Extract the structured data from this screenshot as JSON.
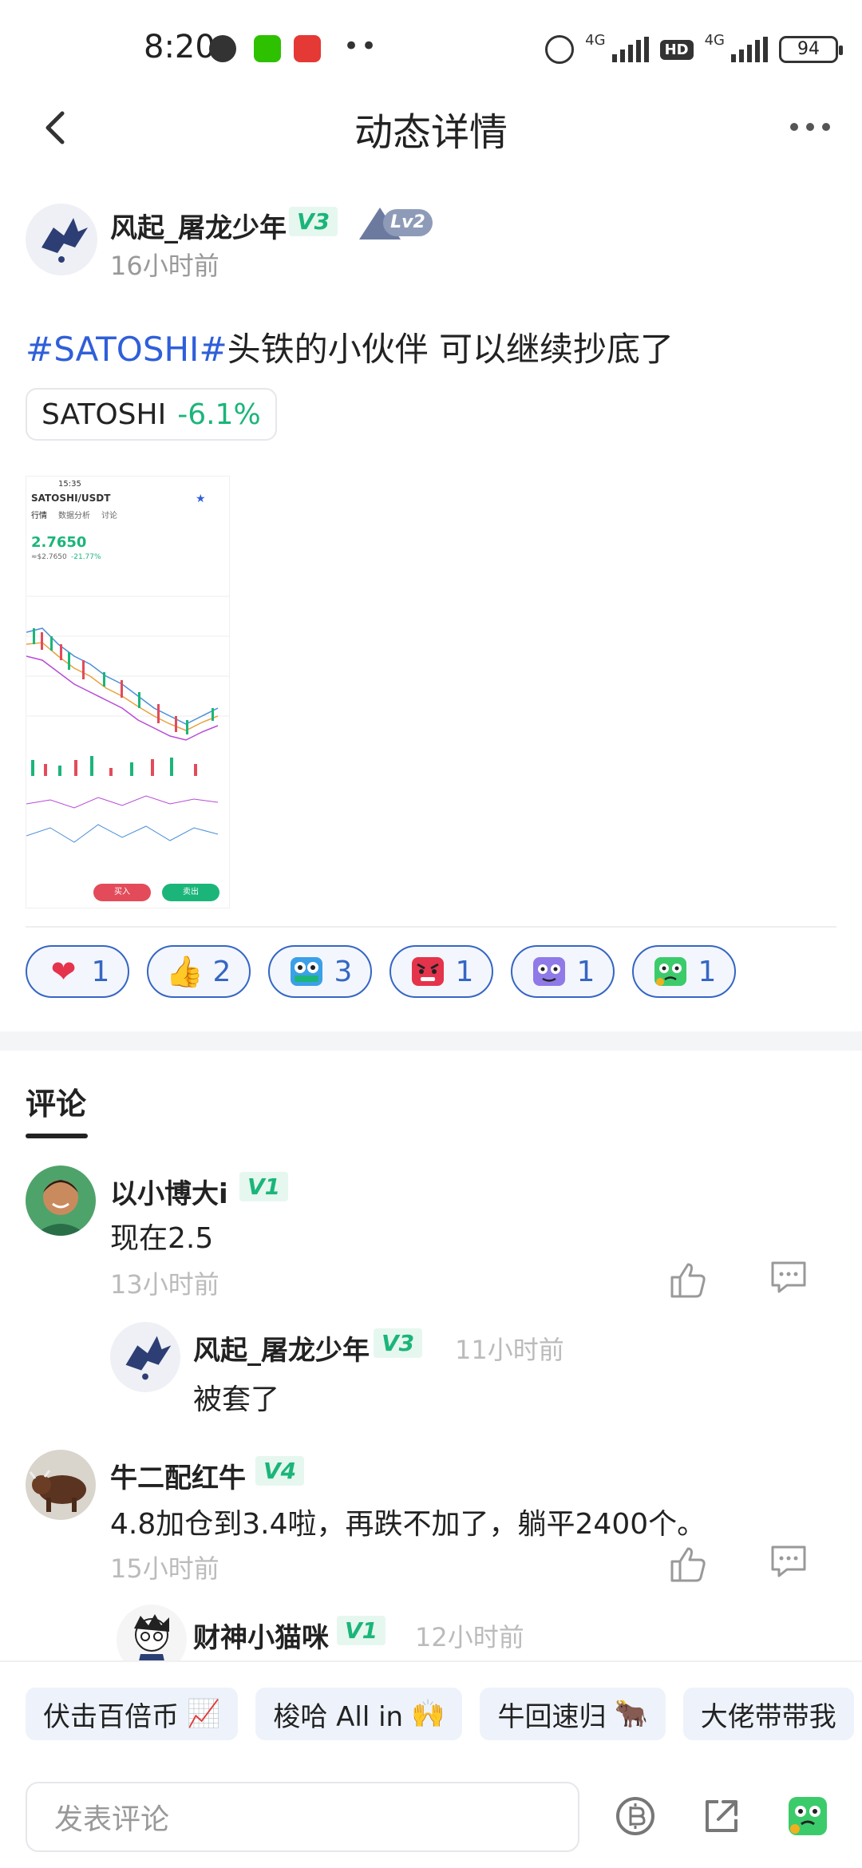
{
  "status_bar": {
    "time": "8:20",
    "network_1": "4G",
    "network_2": "4G",
    "hd": "HD",
    "battery": "94"
  },
  "header": {
    "title": "动态详情"
  },
  "post": {
    "author": "风起_屠龙少年",
    "vip_level": "V3",
    "lv": "Lv2",
    "time": "16小时前",
    "hashtag": "#SATOSHI#",
    "text": "头铁的小伙伴 可以继续抄底了",
    "coin": {
      "symbol": "SATOSHI",
      "change": "-6.1%"
    },
    "screenshot": {
      "time": "15:35",
      "pair": "SATOSHI/USDT",
      "tabs": [
        "行情",
        "数据分析",
        "讨论"
      ],
      "price": "2.7650",
      "price_sub": "≈$2.7650",
      "change": "-21.77%",
      "buy": "买入",
      "sell": "卖出"
    }
  },
  "reactions": [
    {
      "icon": "heart-icon",
      "count": "1"
    },
    {
      "icon": "thumbs-up-icon",
      "count": "2"
    },
    {
      "icon": "hodl-icon",
      "count": "3"
    },
    {
      "icon": "angry-face-icon",
      "count": "1"
    },
    {
      "icon": "purple-face-icon",
      "count": "1"
    },
    {
      "icon": "green-face-icon",
      "count": "1"
    }
  ],
  "comments_tab": "评论",
  "comments": [
    {
      "name": "以小博大i",
      "level": "V1",
      "text": "现在2.5",
      "time": "13小时前"
    },
    {
      "name": "风起_屠龙少年",
      "level": "V3",
      "text": "被套了",
      "time": "11小时前"
    },
    {
      "name": "牛二配红牛",
      "level": "V4",
      "text": "4.8加仓到3.4啦，再跌不加了，躺平2400个。",
      "time": "15小时前"
    },
    {
      "name": "财神小猫咪",
      "level": "V1",
      "time": "12小时前"
    }
  ],
  "quick_replies": [
    {
      "label": "伏击百倍币",
      "emoji": "📈"
    },
    {
      "label": "梭哈 All in",
      "emoji": "🙌"
    },
    {
      "label": "牛回速归",
      "emoji": "🐂"
    },
    {
      "label": "大佬带带我",
      "emoji": ""
    }
  ],
  "comment_input": {
    "placeholder": "发表评论"
  },
  "colors": {
    "accent_blue": "#2f5fd9",
    "up_green": "#1bb57a",
    "reaction_border": "#3566c4"
  }
}
